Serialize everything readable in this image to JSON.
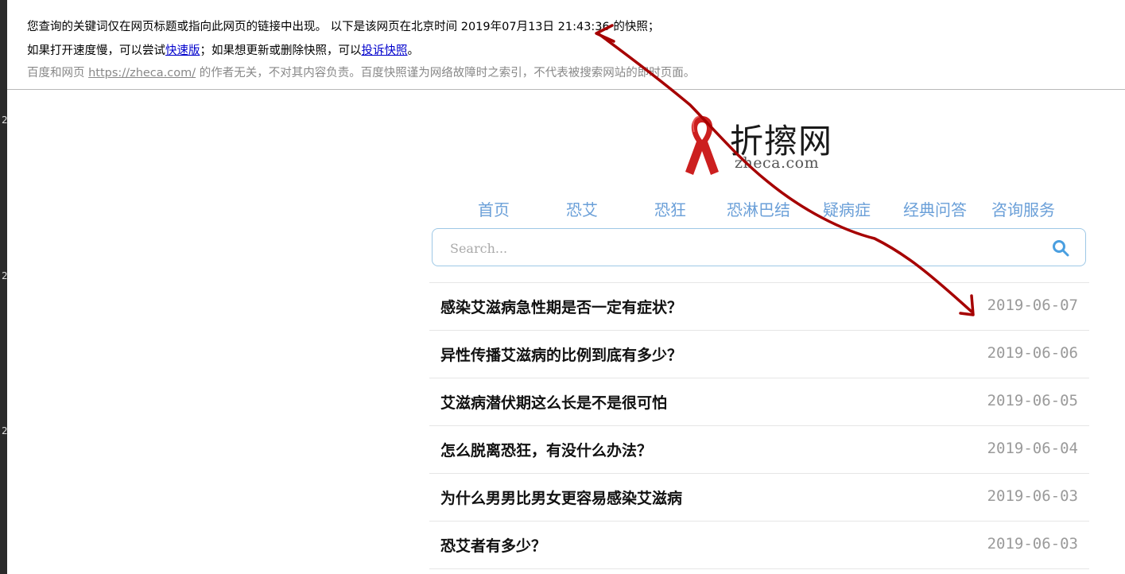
{
  "left_strip": {
    "marks": [
      "2",
      "2",
      "2"
    ]
  },
  "snapshot_banner": {
    "line1": "您查询的关键词仅在网页标题或指向此网页的链接中出现。  以下是该网页在北京时间 2019年07月13日 21:43:36 的快照；",
    "line2_prefix": "如果打开速度慢，可以尝试",
    "fast_link": "快速版",
    "line2_middle": "；如果想更新或删除快照，可以",
    "complaint_link": "投诉快照",
    "line2_suffix": "。",
    "line3_prefix": "百度和网页 ",
    "site_link": "https://zheca.com/",
    "line3_suffix": " 的作者无关，不对其内容负责。百度快照谨为网络故障时之索引，不代表被搜索网站的即时页面。"
  },
  "logo": {
    "cn": "折擦网",
    "en": "zheca.com"
  },
  "nav": {
    "items": [
      {
        "label": "首页"
      },
      {
        "label": "恐艾"
      },
      {
        "label": "恐狂"
      },
      {
        "label": "恐淋巴结"
      },
      {
        "label": "疑病症"
      },
      {
        "label": "经典问答"
      },
      {
        "label": "咨询服务"
      }
    ]
  },
  "search": {
    "placeholder": "Search..."
  },
  "posts": [
    {
      "title": "感染艾滋病急性期是否一定有症状？",
      "date": "2019-06-07"
    },
    {
      "title": "异性传播艾滋病的比例到底有多少？",
      "date": "2019-06-06"
    },
    {
      "title": "艾滋病潜伏期这么长是不是很可怕",
      "date": "2019-06-05"
    },
    {
      "title": "怎么脱离恐狂，有没什么办法？",
      "date": "2019-06-04"
    },
    {
      "title": "为什么男男比男女更容易感染艾滋病",
      "date": "2019-06-03"
    },
    {
      "title": "恐艾者有多少？",
      "date": "2019-06-03"
    }
  ],
  "colors": {
    "nav": "#6a9fd8",
    "ribbon": "#cc1f1f",
    "annotation": "#a60000",
    "search_border": "#9ec8e6"
  }
}
